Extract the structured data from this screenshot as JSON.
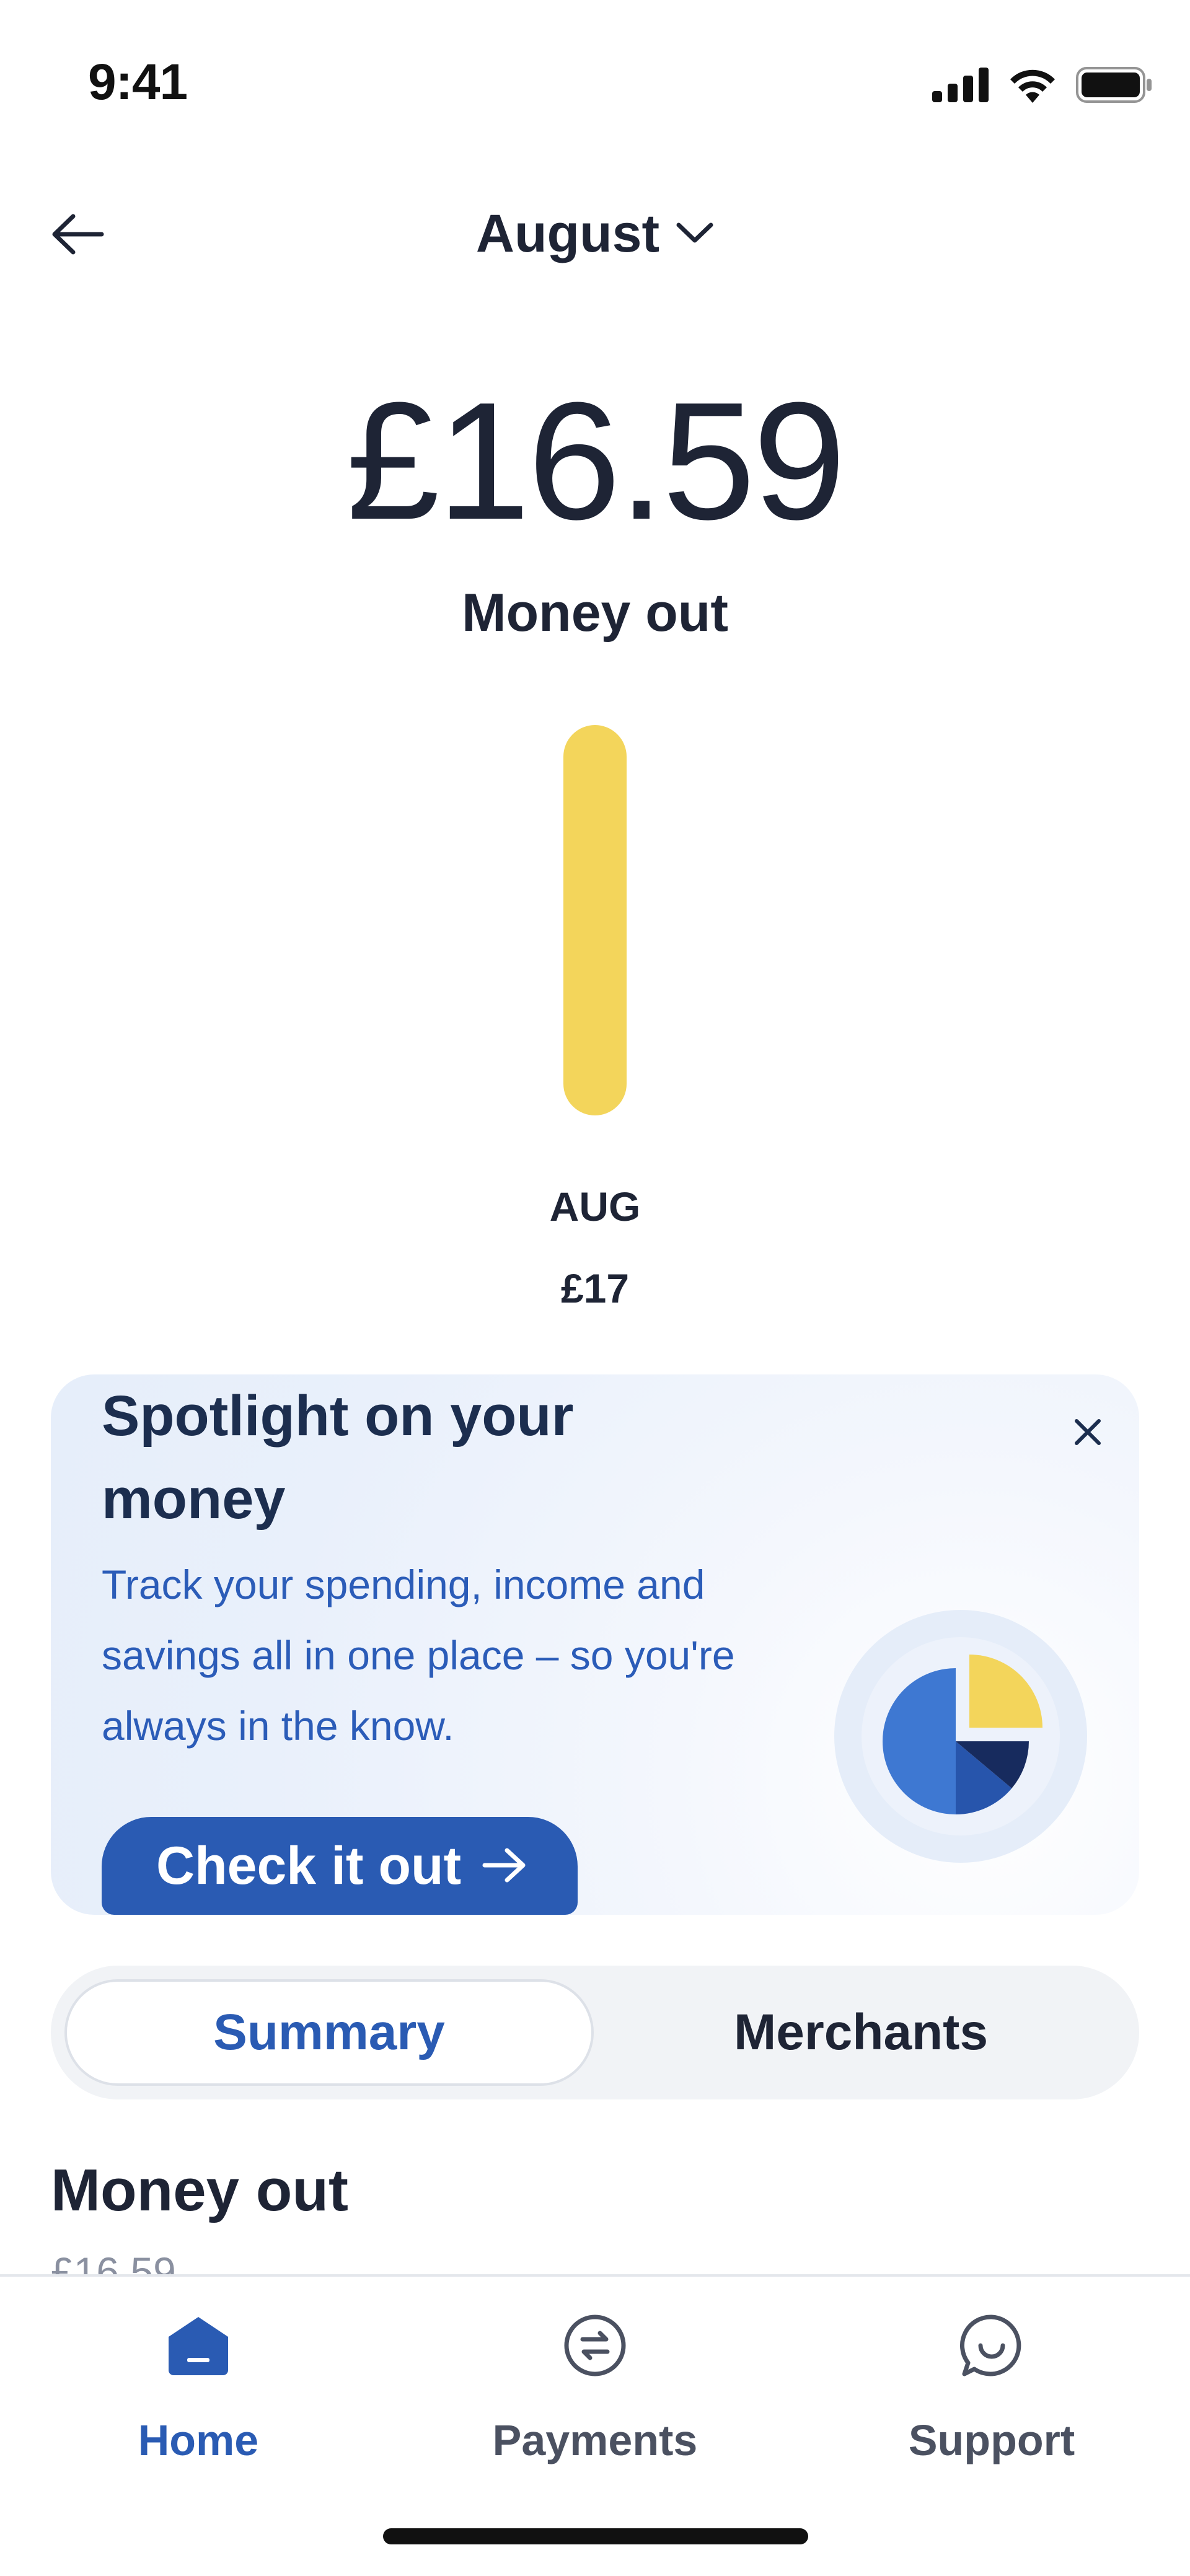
{
  "status_bar": {
    "time": "9:41"
  },
  "header": {
    "month": "August"
  },
  "summary": {
    "amount": "£16.59",
    "label": "Money out"
  },
  "chart_data": {
    "type": "bar",
    "categories": [
      "AUG"
    ],
    "values": [
      17
    ],
    "value_labels": [
      "£17"
    ],
    "title": "",
    "xlabel": "",
    "ylabel": "",
    "ylim": [
      0,
      17
    ],
    "bar_color": "#f3d55b"
  },
  "spotlight": {
    "title": "Spotlight on your money",
    "body": "Track your spending, income and savings all in one place – so you're always in the know.",
    "cta_label": "Check it out",
    "colors": {
      "yellow": "#f3d55b",
      "light_blue": "#3e78d2",
      "mid_blue": "#2755ac",
      "dark_navy": "#172b5e"
    }
  },
  "tabs": [
    {
      "label": "Summary",
      "selected": true
    },
    {
      "label": "Merchants",
      "selected": false
    }
  ],
  "section": {
    "title": "Money out",
    "subtitle": "£16.59"
  },
  "bottom_nav": {
    "items": [
      {
        "label": "Home",
        "icon": "home-icon",
        "active": true
      },
      {
        "label": "Payments",
        "icon": "payments-transfer-icon",
        "active": false
      },
      {
        "label": "Support",
        "icon": "support-chat-icon",
        "active": false
      }
    ]
  },
  "colors": {
    "brand": "#2a5bb3",
    "text": "#1e2435",
    "muted": "#4b5161"
  }
}
